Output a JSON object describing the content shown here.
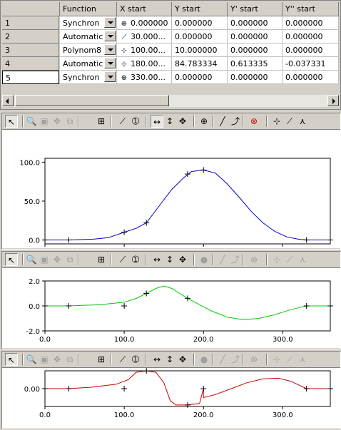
{
  "grid": {
    "headers": [
      "Function",
      "X start",
      "Y start",
      "Y' start",
      "Y'' start"
    ],
    "rows": [
      {
        "num": "1",
        "func": "Synchron",
        "icon": "target-icon",
        "icon_glyph": "⊕",
        "x": "0.000000",
        "y": "0.000000",
        "y1": "0.000000",
        "y2": "0.000000"
      },
      {
        "num": "2",
        "func": "Automatic",
        "icon": "slope-icon",
        "icon_glyph": "⟋",
        "x": "30.000...",
        "y": "0.000000",
        "y1": "0.000000",
        "y2": "0.000000"
      },
      {
        "num": "3",
        "func": "Polynom8",
        "icon": "tangent-icon",
        "icon_glyph": "⊹",
        "x": "100.00...",
        "y": "10.000000",
        "y1": "0.000000",
        "y2": "0.000000"
      },
      {
        "num": "4",
        "func": "Automatic",
        "icon": "peak-icon",
        "icon_glyph": "⊹",
        "x": "180.00...",
        "y": "84.783334",
        "y1": "0.613335",
        "y2": "-0.037331"
      },
      {
        "num": "5",
        "func": "Synchron",
        "icon": "target-icon",
        "icon_glyph": "⊕",
        "x": "330.00...",
        "y": "0.000000",
        "y1": "0.000000",
        "y2": "0.000000"
      }
    ]
  },
  "toolbar_full": [
    {
      "name": "pointer-icon",
      "glyph": "↖",
      "state": "pressed"
    },
    {
      "name": "zoom-icon",
      "glyph": "🔍",
      "state": ""
    },
    {
      "name": "zoom-rect-icon",
      "glyph": "▣",
      "state": "dis"
    },
    {
      "name": "pan-icon",
      "glyph": "✥",
      "state": "dis"
    },
    {
      "name": "copy-icon",
      "glyph": "⧉",
      "state": "dis"
    },
    {
      "name": "grid-icon",
      "glyph": "⊞",
      "state": ""
    },
    {
      "name": "pen-icon",
      "glyph": "⟋",
      "state": ""
    },
    {
      "name": "number-one-icon",
      "glyph": "➀",
      "state": ""
    },
    {
      "name": "fit-horizontal-icon",
      "glyph": "↔",
      "state": "pressed"
    },
    {
      "name": "fit-vertical-icon",
      "glyph": "↕",
      "state": ""
    },
    {
      "name": "fit-both-icon",
      "glyph": "✥",
      "state": ""
    },
    {
      "name": "add-point-icon",
      "glyph": "⊕",
      "state": ""
    },
    {
      "name": "line-icon",
      "glyph": "╱",
      "state": ""
    },
    {
      "name": "curve-icon",
      "glyph": "⤴",
      "state": ""
    },
    {
      "name": "delete-point-icon",
      "glyph": "⊗",
      "state": "red"
    },
    {
      "name": "h-tangent-icon",
      "glyph": "⊹",
      "state": ""
    },
    {
      "name": "slope-tool-icon",
      "glyph": "⟋",
      "state": ""
    },
    {
      "name": "peak-tool-icon",
      "glyph": "⋏",
      "state": ""
    }
  ],
  "toolbar_dim": [
    {
      "name": "pointer-icon",
      "glyph": "↖",
      "state": "pressed"
    },
    {
      "name": "zoom-icon",
      "glyph": "🔍",
      "state": ""
    },
    {
      "name": "zoom-rect-icon",
      "glyph": "▣",
      "state": "dis"
    },
    {
      "name": "pan-icon",
      "glyph": "✥",
      "state": "dis"
    },
    {
      "name": "copy-icon",
      "glyph": "⧉",
      "state": "dis"
    },
    {
      "name": "grid-icon",
      "glyph": "⊞",
      "state": ""
    },
    {
      "name": "pen-icon",
      "glyph": "⟋",
      "state": ""
    },
    {
      "name": "number-one-icon",
      "glyph": "➀",
      "state": ""
    },
    {
      "name": "fit-horizontal-icon",
      "glyph": "↔",
      "state": ""
    },
    {
      "name": "fit-vertical-icon",
      "glyph": "↕",
      "state": ""
    },
    {
      "name": "fit-both-icon",
      "glyph": "✥",
      "state": ""
    },
    {
      "name": "add-point-icon",
      "glyph": "●",
      "state": "dis"
    },
    {
      "name": "line-icon",
      "glyph": "╱",
      "state": "dis"
    },
    {
      "name": "curve-icon",
      "glyph": "⤴",
      "state": "dis"
    },
    {
      "name": "delete-point-icon",
      "glyph": "⊗",
      "state": "dis"
    },
    {
      "name": "h-tangent-icon",
      "glyph": "⊹",
      "state": "dis"
    },
    {
      "name": "slope-tool-icon",
      "glyph": "⟋",
      "state": "dis"
    },
    {
      "name": "peak-tool-icon",
      "glyph": "⋏",
      "state": "dis"
    }
  ],
  "chart_data": [
    {
      "type": "line",
      "color": "#0000c8",
      "xticks": [
        "0.0",
        "100.0",
        "200.0",
        "300.0"
      ],
      "yticks": [
        "0.0",
        "50.0",
        "100.0"
      ],
      "xlim": [
        0,
        360
      ],
      "ylim": [
        -5,
        105
      ],
      "points": [
        [
          0,
          0
        ],
        [
          30,
          0
        ],
        [
          100,
          10
        ],
        [
          128,
          22
        ],
        [
          180,
          84.78
        ],
        [
          200,
          90
        ],
        [
          330,
          0
        ],
        [
          360,
          0
        ]
      ],
      "curve": [
        [
          0,
          0
        ],
        [
          30,
          0
        ],
        [
          60,
          1
        ],
        [
          80,
          3
        ],
        [
          100,
          10
        ],
        [
          115,
          15
        ],
        [
          128,
          22
        ],
        [
          145,
          45
        ],
        [
          160,
          65
        ],
        [
          175,
          80
        ],
        [
          185,
          88
        ],
        [
          200,
          90
        ],
        [
          215,
          86
        ],
        [
          230,
          72
        ],
        [
          245,
          55
        ],
        [
          260,
          37
        ],
        [
          275,
          22
        ],
        [
          290,
          11
        ],
        [
          305,
          4
        ],
        [
          320,
          1
        ],
        [
          330,
          0
        ],
        [
          360,
          0
        ]
      ]
    },
    {
      "type": "line",
      "color": "#00c800",
      "xticks": [
        "0.0",
        "100.0",
        "200.0",
        "300.0"
      ],
      "yticks": [
        "-2.0",
        "0.0",
        "2.0"
      ],
      "xlim": [
        0,
        360
      ],
      "ylim": [
        -2,
        2
      ],
      "points": [
        [
          0,
          0
        ],
        [
          30,
          0
        ],
        [
          100,
          0
        ],
        [
          128,
          1
        ],
        [
          180,
          0.61
        ],
        [
          330,
          0
        ],
        [
          360,
          0
        ]
      ],
      "curve": [
        [
          0,
          0
        ],
        [
          30,
          0
        ],
        [
          70,
          0.1
        ],
        [
          100,
          0.3
        ],
        [
          115,
          0.6
        ],
        [
          128,
          1.0
        ],
        [
          140,
          1.4
        ],
        [
          150,
          1.6
        ],
        [
          160,
          1.4
        ],
        [
          170,
          1.0
        ],
        [
          180,
          0.6
        ],
        [
          195,
          0.1
        ],
        [
          210,
          -0.4
        ],
        [
          230,
          -0.9
        ],
        [
          250,
          -1.1
        ],
        [
          270,
          -1.0
        ],
        [
          290,
          -0.7
        ],
        [
          310,
          -0.3
        ],
        [
          330,
          0
        ],
        [
          360,
          0
        ]
      ]
    },
    {
      "type": "line",
      "color": "#c80000",
      "xticks": [
        "0.0",
        "100.0",
        "200.0",
        "300.0"
      ],
      "yticks": [
        "0.00"
      ],
      "xlim": [
        0,
        360
      ],
      "ylim": [
        -0.06,
        0.06
      ],
      "points": [
        [
          0,
          0
        ],
        [
          30,
          0
        ],
        [
          100,
          0
        ],
        [
          128,
          0.06
        ],
        [
          180,
          -0.055
        ],
        [
          200,
          0
        ],
        [
          330,
          0
        ],
        [
          360,
          0
        ]
      ],
      "curve": [
        [
          0,
          0
        ],
        [
          30,
          0
        ],
        [
          60,
          0.005
        ],
        [
          90,
          0.015
        ],
        [
          105,
          0.03
        ],
        [
          115,
          0.055
        ],
        [
          128,
          0.06
        ],
        [
          140,
          0.055
        ],
        [
          150,
          0.02
        ],
        [
          158,
          -0.04
        ],
        [
          165,
          -0.055
        ],
        [
          180,
          -0.055
        ],
        [
          195,
          -0.05
        ],
        [
          200,
          0
        ],
        [
          200,
          -0.03
        ],
        [
          215,
          -0.02
        ],
        [
          235,
          0.0
        ],
        [
          255,
          0.02
        ],
        [
          275,
          0.033
        ],
        [
          295,
          0.035
        ],
        [
          310,
          0.025
        ],
        [
          330,
          0
        ],
        [
          360,
          0
        ]
      ]
    }
  ]
}
